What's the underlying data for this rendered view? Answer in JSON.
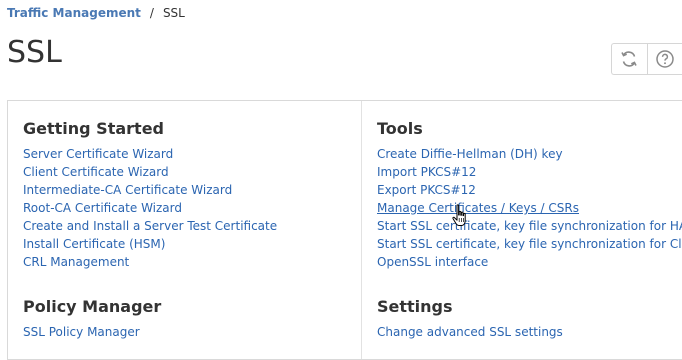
{
  "breadcrumb": {
    "parent": "Traffic Management",
    "separator": "/",
    "current": "SSL"
  },
  "page": {
    "title": "SSL"
  },
  "toolbar": {
    "icons": [
      "refresh-icon",
      "help-icon"
    ]
  },
  "getting_started": {
    "title": "Getting Started",
    "links": [
      "Server Certificate Wizard",
      "Client Certificate Wizard",
      "Intermediate-CA Certificate Wizard",
      "Root-CA Certificate Wizard",
      "Create and Install a Server Test Certificate",
      "Install Certificate (HSM)",
      "CRL Management"
    ]
  },
  "policy_manager": {
    "title": "Policy Manager",
    "links": [
      "SSL Policy Manager"
    ]
  },
  "tools": {
    "title": "Tools",
    "links": [
      "Create Diffie-Hellman (DH) key",
      "Import PKCS#12",
      "Export PKCS#12",
      "Manage Certificates / Keys / CSRs",
      "Start SSL certificate, key file synchronization for HA",
      "Start SSL certificate, key file synchronization for Cluster",
      "OpenSSL interface"
    ]
  },
  "settings": {
    "title": "Settings",
    "links": [
      "Change advanced SSL settings"
    ]
  },
  "colors": {
    "link": "#2b65b1",
    "breadcrumb_link": "#4a79b4",
    "text": "#333333",
    "border": "#d9d9d9"
  }
}
